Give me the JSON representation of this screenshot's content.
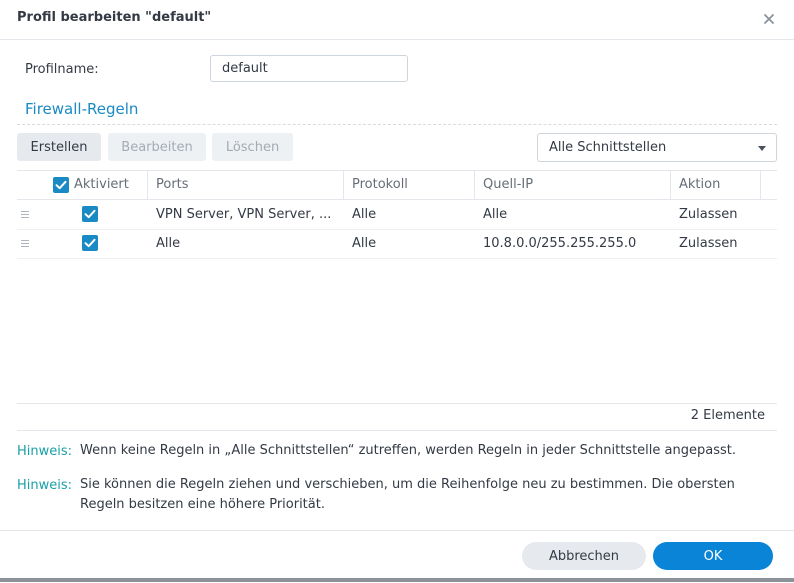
{
  "dialog": {
    "title": "Profil bearbeiten \"default\""
  },
  "profile": {
    "label": "Profilname:",
    "value": "default"
  },
  "section": {
    "title": "Firewall-Regeln"
  },
  "toolbar": {
    "create_label": "Erstellen",
    "edit_label": "Bearbeiten",
    "delete_label": "Löschen",
    "interface_select": "Alle Schnittstellen"
  },
  "table": {
    "columns": [
      "Aktiviert",
      "Ports",
      "Protokoll",
      "Quell-IP",
      "Aktion"
    ],
    "rows": [
      {
        "enabled": true,
        "ports": "VPN Server, VPN Server, ...",
        "protocol": "Alle",
        "source_ip": "Alle",
        "action": "Zulassen"
      },
      {
        "enabled": true,
        "ports": "Alle",
        "protocol": "Alle",
        "source_ip": "10.8.0.0/255.255.255.0",
        "action": "Zulassen"
      }
    ],
    "count_text": "2 Elemente"
  },
  "hints": [
    {
      "label": "Hinweis:",
      "text": "Wenn keine Regeln in „Alle Schnittstellen“ zutreffen, werden Regeln in jeder Schnittstelle angepasst."
    },
    {
      "label": "Hinweis:",
      "text": "Sie können die Regeln ziehen und verschieben, um die Reihenfolge neu zu bestimmen. Die obersten Regeln besitzen eine höhere Priorität."
    }
  ],
  "footer": {
    "cancel_label": "Abbrechen",
    "ok_label": "OK"
  },
  "colors": {
    "accent": "#1a8ac4",
    "hint": "#1aa0a6",
    "primary_button": "#0a84d6",
    "secondary_button": "#e6eaef"
  },
  "icons": {
    "close": "close-icon",
    "drag": "drag-handle-icon",
    "check": "checkmark-icon",
    "dropdown": "chevron-down-icon"
  }
}
